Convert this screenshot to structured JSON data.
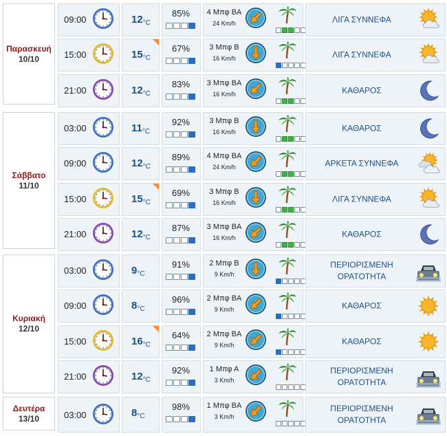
{
  "days": [
    {
      "name": "Παρασκευή",
      "date": "10/10",
      "rows": [
        {
          "time": "09:00",
          "clock": "blue",
          "temp": "12",
          "warm": false,
          "hum": "85%",
          "hbars": 3,
          "wind_line1": "4 Μπφ ΒΑ",
          "wind_line2": "24 Km/h",
          "wind_dir": "NE",
          "sea": "green2",
          "cond": "ΛΙΓΑ ΣΥΝΝΕΦΑ",
          "icon": "sun-cloud-icon"
        },
        {
          "time": "15:00",
          "clock": "yellow",
          "temp": "15",
          "warm": true,
          "hum": "67%",
          "hbars": 3,
          "wind_line1": "3 Μπφ Β",
          "wind_line2": "16 Km/h",
          "wind_dir": "N",
          "sea": "blue1",
          "cond": "ΛΙΓΑ ΣΥΝΝΕΦΑ",
          "icon": "sun-cloud-icon"
        },
        {
          "time": "21:00",
          "clock": "purple",
          "temp": "12",
          "warm": false,
          "hum": "83%",
          "hbars": 3,
          "wind_line1": "3 Μπφ ΒΑ",
          "wind_line2": "16 Km/h",
          "wind_dir": "NE",
          "sea": "green2",
          "cond": "ΚΑΘΑΡΟΣ",
          "icon": "moon-icon"
        }
      ]
    },
    {
      "name": "Σάββατο",
      "date": "11/10",
      "rows": [
        {
          "time": "03:00",
          "clock": "blue",
          "temp": "11",
          "warm": false,
          "hum": "92%",
          "hbars": 3,
          "wind_line1": "3 Μπφ Β",
          "wind_line2": "16 Km/h",
          "wind_dir": "N",
          "sea": "green2",
          "cond": "ΚΑΘΑΡΟΣ",
          "icon": "moon-icon"
        },
        {
          "time": "09:00",
          "clock": "blue",
          "temp": "12",
          "warm": false,
          "hum": "89%",
          "hbars": 3,
          "wind_line1": "4 Μπφ ΒΑ",
          "wind_line2": "24 Km/h",
          "wind_dir": "NE",
          "sea": "green2",
          "cond": "ΑΡΚΕΤΑ ΣΥΝΝΕΦΑ",
          "icon": "sun-clouds-icon"
        },
        {
          "time": "15:00",
          "clock": "yellow",
          "temp": "15",
          "warm": true,
          "hum": "69%",
          "hbars": 3,
          "wind_line1": "3 Μπφ Β",
          "wind_line2": "16 Km/h",
          "wind_dir": "N",
          "sea": "green2",
          "cond": "ΛΙΓΑ ΣΥΝΝΕΦΑ",
          "icon": "sun-cloud-icon"
        },
        {
          "time": "21:00",
          "clock": "purple",
          "temp": "12",
          "warm": false,
          "hum": "87%",
          "hbars": 3,
          "wind_line1": "3 Μπφ ΒΑ",
          "wind_line2": "16 Km/h",
          "wind_dir": "NE",
          "sea": "green2",
          "cond": "ΚΑΘΑΡΟΣ",
          "icon": "moon-icon"
        }
      ]
    },
    {
      "name": "Κυριακή",
      "date": "12/10",
      "rows": [
        {
          "time": "03:00",
          "clock": "blue",
          "temp": "9",
          "warm": false,
          "hum": "91%",
          "hbars": 3,
          "wind_line1": "2 Μπφ Β",
          "wind_line2": "9 Km/h",
          "wind_dir": "N",
          "sea": "blue1",
          "cond": "ΠΕΡΙΟΡΙΣΜΕΝΗ ΟΡΑΤΟΤΗΤΑ",
          "icon": "fog-car-icon"
        },
        {
          "time": "09:00",
          "clock": "blue",
          "temp": "8",
          "warm": false,
          "hum": "96%",
          "hbars": 3,
          "wind_line1": "2 Μπφ ΒΑ",
          "wind_line2": "9 Km/h",
          "wind_dir": "NE",
          "sea": "blue1",
          "cond": "ΚΑΘΑΡΟΣ",
          "icon": "sun-icon"
        },
        {
          "time": "15:00",
          "clock": "yellow",
          "temp": "16",
          "warm": true,
          "hum": "64%",
          "hbars": 3,
          "wind_line1": "2 Μπφ ΒΑ",
          "wind_line2": "9 Km/h",
          "wind_dir": "NE",
          "sea": "blue1",
          "cond": "ΚΑΘΑΡΟΣ",
          "icon": "sun-icon"
        },
        {
          "time": "21:00",
          "clock": "purple",
          "temp": "12",
          "warm": false,
          "hum": "92%",
          "hbars": 3,
          "wind_line1": "1 Μπφ Α",
          "wind_line2": "3 Km/h",
          "wind_dir": "E",
          "sea": "none",
          "cond": "ΠΕΡΙΟΡΙΣΜΕΝΗ ΟΡΑΤΟΤΗΤΑ",
          "icon": "fog-car-icon"
        }
      ]
    },
    {
      "name": "Δευτέρα",
      "date": "13/10",
      "rows": [
        {
          "time": "03:00",
          "clock": "blue",
          "temp": "8",
          "warm": false,
          "hum": "98%",
          "hbars": 3,
          "wind_line1": "1 Μπφ ΒΑ",
          "wind_line2": "3 Km/h",
          "wind_dir": "NE",
          "sea": "none",
          "cond": "ΠΕΡΙΟΡΙΣΜΕΝΗ ΟΡΑΤΟΤΗΤΑ",
          "icon": "fog-car-icon"
        }
      ]
    }
  ],
  "units": {
    "temp": "°C"
  },
  "colors": {
    "clock_blue": "#3b6fc4",
    "clock_yellow": "#e8b923",
    "clock_purple": "#8a45b5",
    "warm_marker": "#ff8a2a",
    "humidity_bar": "#2b6dbf",
    "sea_green": "#3db43d",
    "sea_blue": "#2b6dbf",
    "condition_text": "#1b4f86",
    "day_name": "#8b1a1a"
  }
}
